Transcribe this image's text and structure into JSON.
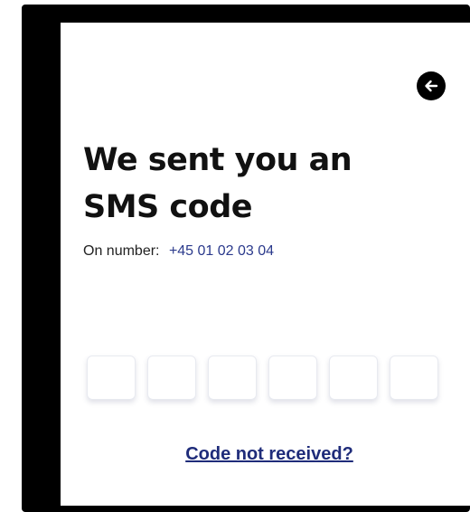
{
  "header": {
    "back_icon": "arrow-left-icon"
  },
  "main": {
    "title": "We sent you an SMS code",
    "number_label": "On number:",
    "phone_number": "+45 01 02 03 04",
    "code_digits": [
      "",
      "",
      "",
      "",
      "",
      ""
    ],
    "resend_link": "Code not received?"
  },
  "colors": {
    "accent": "#1f2c7a",
    "phone_number": "#2b3a8c",
    "frame": "#000000",
    "title": "#111111"
  }
}
